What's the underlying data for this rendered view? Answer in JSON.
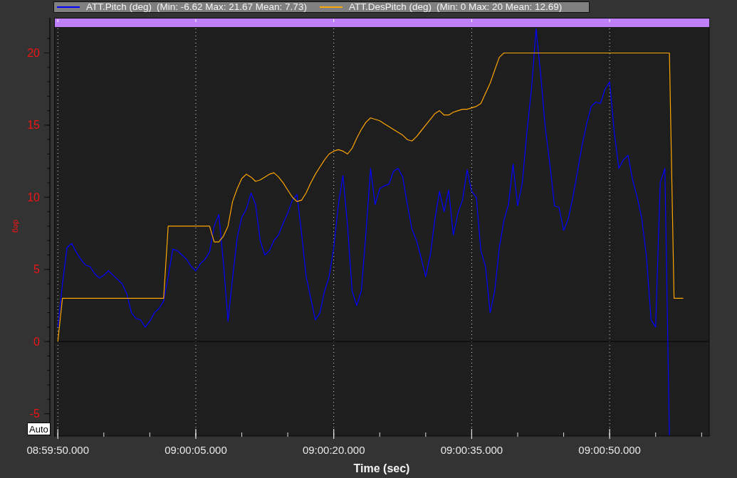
{
  "legend_stats": [
    "(Min: -6.62 Max: 21.67 Mean: 7.73)",
    "(Min: 0 Max: 20 Mean: 12.69)"
  ],
  "chart_data": {
    "type": "line",
    "xlabel": "Time (sec)",
    "ylabel": "deg",
    "legend": "top",
    "categories": [
      "08:59:50.000",
      null,
      null,
      null,
      null,
      null,
      null,
      null,
      null,
      null,
      null,
      null,
      null,
      null,
      null,
      null,
      null,
      null,
      null,
      null,
      null,
      null,
      null,
      null,
      null,
      null,
      null,
      null,
      null,
      null,
      "09:00:05.000",
      null,
      null,
      null,
      null,
      null,
      null,
      null,
      null,
      null,
      null,
      null,
      null,
      null,
      null,
      null,
      null,
      null,
      null,
      null,
      null,
      null,
      null,
      null,
      null,
      null,
      null,
      null,
      null,
      null,
      "09:00:20.000",
      null,
      null,
      null,
      null,
      null,
      null,
      null,
      null,
      null,
      null,
      null,
      null,
      null,
      null,
      null,
      null,
      null,
      null,
      null,
      null,
      null,
      null,
      null,
      null,
      null,
      null,
      null,
      null,
      null,
      "09:00:35.000",
      null,
      null,
      null,
      null,
      null,
      null,
      null,
      null,
      null,
      null,
      null,
      null,
      null,
      null,
      null,
      null,
      null,
      null,
      null,
      null,
      null,
      null,
      null,
      null,
      null,
      null,
      null,
      null,
      null,
      "09:00:50.000",
      null,
      null,
      null,
      null,
      null,
      null,
      null,
      null,
      null,
      null,
      null,
      null,
      null,
      null,
      null,
      null,
      null,
      null,
      null,
      null,
      null
    ],
    "series": [
      {
        "name": "ATT.Pitch (deg)",
        "color": "#0000ff",
        "values": [
          1.0,
          4.0,
          6.5,
          6.8,
          6.2,
          5.7,
          5.3,
          5.2,
          4.7,
          4.4,
          4.6,
          4.9,
          4.6,
          4.3,
          4.0,
          3.3,
          2.0,
          1.6,
          1.5,
          1.0,
          1.4,
          2.0,
          2.3,
          2.8,
          4.5,
          6.4,
          6.3,
          6.0,
          5.7,
          5.2,
          4.9,
          5.4,
          5.7,
          6.2,
          8.0,
          8.8,
          5.5,
          1.4,
          4.4,
          7.2,
          8.6,
          9.2,
          10.3,
          9.5,
          7.0,
          6.0,
          6.3,
          7.0,
          7.4,
          8.2,
          8.9,
          9.8,
          10.2,
          7.5,
          4.5,
          3.0,
          1.5,
          2.0,
          3.5,
          4.5,
          6.5,
          9.5,
          11.5,
          8.0,
          3.5,
          2.5,
          3.5,
          7.5,
          12.0,
          9.5,
          10.6,
          10.8,
          10.9,
          11.8,
          12.0,
          11.4,
          9.5,
          7.8,
          7.0,
          5.8,
          4.5,
          6.0,
          8.5,
          10.4,
          9.0,
          10.5,
          7.4,
          8.9,
          9.8,
          11.9,
          10.4,
          10.0,
          6.3,
          5.2,
          2.0,
          3.5,
          6.5,
          8.4,
          9.5,
          12.3,
          9.4,
          11.0,
          14.5,
          17.5,
          21.67,
          18.5,
          14.8,
          12.3,
          9.4,
          9.3,
          7.7,
          8.5,
          10.0,
          11.8,
          13.6,
          15.1,
          16.3,
          16.6,
          16.5,
          17.5,
          18.0,
          14.5,
          12.0,
          12.6,
          12.9,
          11.2,
          10.0,
          8.5,
          5.9,
          1.5,
          1.0,
          11.0,
          12.0,
          -6.5,
          null,
          null,
          null,
          null,
          null,
          null,
          null,
          null
        ]
      },
      {
        "name": "ATT.DesPitch (deg)",
        "color": "#ffa500",
        "values": [
          0,
          3,
          3,
          3,
          3,
          3,
          3,
          3,
          3,
          3,
          3,
          3,
          3,
          3,
          3,
          3,
          3,
          3,
          3,
          3,
          3,
          3,
          3,
          3,
          8,
          8,
          8,
          8,
          8,
          8,
          8,
          8,
          8,
          8,
          6.9,
          6.9,
          7.3,
          8.0,
          9.7,
          10.6,
          11.3,
          11.6,
          11.4,
          11.1,
          11.2,
          11.4,
          11.6,
          11.7,
          11.4,
          11.0,
          10.5,
          10.0,
          9.7,
          9.8,
          10.3,
          11.0,
          11.6,
          12.1,
          12.6,
          13.0,
          13.2,
          13.3,
          13.2,
          13.0,
          13.4,
          14.1,
          14.7,
          15.2,
          15.5,
          15.4,
          15.3,
          15.1,
          14.9,
          14.7,
          14.5,
          14.3,
          14.0,
          13.9,
          14.2,
          14.6,
          15.0,
          15.4,
          15.8,
          16.0,
          15.7,
          15.7,
          15.9,
          16.0,
          16.1,
          16.1,
          16.2,
          16.3,
          16.5,
          17.2,
          17.9,
          18.8,
          19.7,
          20,
          20,
          20,
          20,
          20,
          20,
          20,
          20,
          20,
          20,
          20,
          20,
          20,
          20,
          20,
          20,
          20,
          20,
          20,
          20,
          20,
          20,
          20,
          20,
          20,
          20,
          20,
          20,
          20,
          20,
          20,
          20,
          20,
          20,
          20,
          20,
          20,
          3,
          3,
          3,
          null,
          null,
          null,
          null,
          null
        ]
      }
    ],
    "ylim": [
      -6.5,
      21.8
    ],
    "yticks": [
      -5,
      0,
      5,
      10,
      15,
      20
    ]
  },
  "auto_button": {
    "label": "Auto"
  }
}
